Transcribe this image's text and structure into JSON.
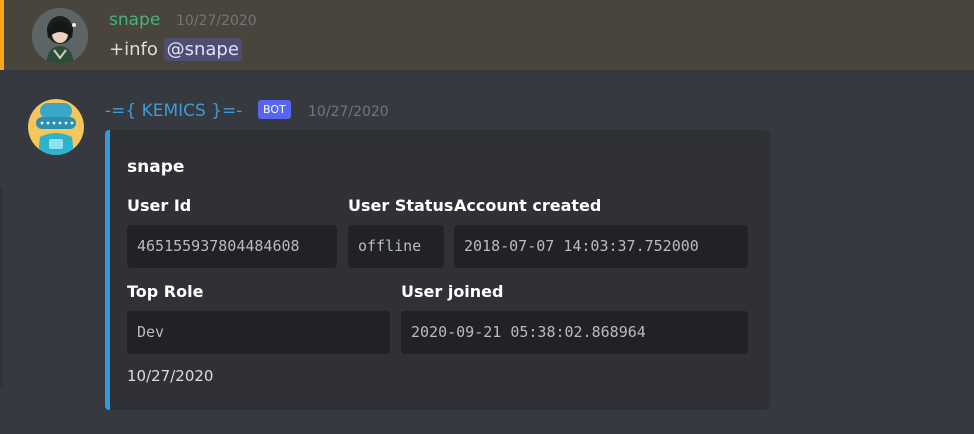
{
  "message1": {
    "author": "snape",
    "timestamp": "10/27/2020",
    "command": "+info",
    "mention": "@snape"
  },
  "message2": {
    "author": "-={ KEMICS }=-",
    "tag": "BOT",
    "timestamp": "10/27/2020"
  },
  "embed": {
    "title": "snape",
    "fields": {
      "user_id": {
        "name": "User Id",
        "value": "465155937804484608"
      },
      "user_status": {
        "name": "User Status",
        "value": "offline"
      },
      "account_created": {
        "name": "Account created",
        "value": "2018-07-07 14:03:37.752000"
      },
      "top_role": {
        "name": "Top Role",
        "value": "Dev"
      },
      "user_joined": {
        "name": "User joined",
        "value": "2020-09-21 05:38:02.868964"
      }
    },
    "footer": "10/27/2020"
  },
  "colors": {
    "highlight_bg": "#49443c",
    "highlight_bar": "#faa81a",
    "username_green": "#43b581",
    "bot_name_blue": "#3f9bd8",
    "bot_tag": "#5865f2",
    "embed_border": "#3498db"
  }
}
